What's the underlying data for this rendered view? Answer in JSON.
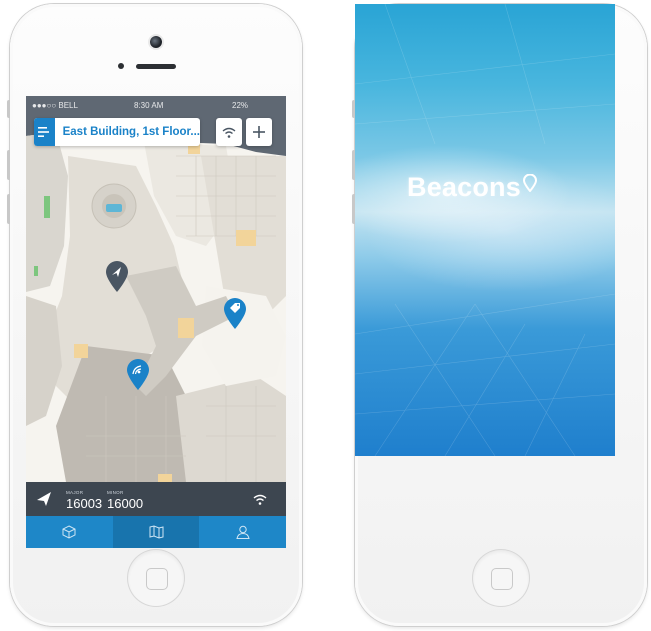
{
  "map_screen": {
    "status_bar": {
      "carrier": "●●●○○ BELL",
      "time": "8:30 AM",
      "battery": "22%"
    },
    "location_title": "East Building, 1st Floor...",
    "info_bar": {
      "major_label": "MAJOR",
      "major_value": "16003",
      "minor_label": "MINOR",
      "minor_value": "16000"
    },
    "tabs": [
      {
        "icon": "cube-icon",
        "active": false
      },
      {
        "icon": "map-icon",
        "active": true
      },
      {
        "icon": "person-icon",
        "active": false
      }
    ]
  },
  "splash_screen": {
    "brand_name": "Beacons"
  },
  "colors": {
    "accent": "#1a82c8",
    "tab_active": "#1874ad",
    "info_bar": "#3d4650",
    "marker_dark": "#4a5663"
  }
}
